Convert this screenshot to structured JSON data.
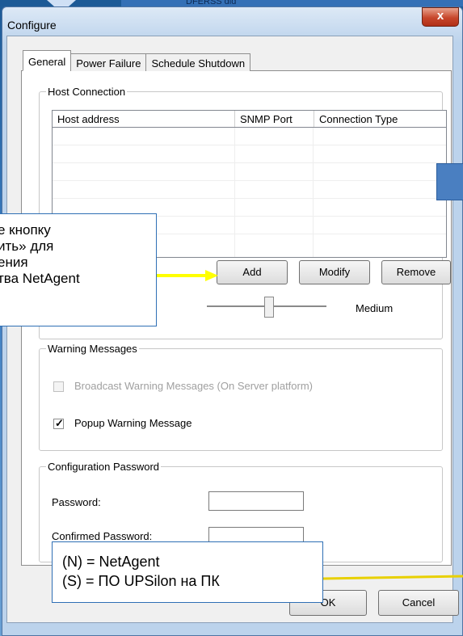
{
  "top_strip_text": "DFERSS dld",
  "window": {
    "title": "Configure",
    "close_label": "x"
  },
  "tabs": [
    {
      "label": "General"
    },
    {
      "label": "Power Failure"
    },
    {
      "label": "Schedule Shutdown"
    }
  ],
  "host_connection": {
    "legend": "Host Connection",
    "columns": [
      "Host address",
      "SNMP Port",
      "Connection Type"
    ],
    "rows": [],
    "buttons": {
      "add": "Add",
      "modify": "Modify",
      "remove": "Remove"
    }
  },
  "slider": {
    "value_label": "Medium",
    "level": 0.5
  },
  "warning_messages": {
    "legend": "Warning Messages",
    "broadcast": {
      "label": "Broadcast Warning Messages (On Server platform)",
      "checked": false,
      "enabled": false
    },
    "popup": {
      "label": "Popup Warning Message",
      "checked": true
    }
  },
  "configuration_password": {
    "legend": "Configuration Password",
    "password_label": "Password:",
    "password_value": "",
    "confirmed_label": "Confirmed Password:",
    "confirmed_value": ""
  },
  "dialog_buttons": {
    "ok": "OK",
    "cancel": "Cancel"
  },
  "callout_add": {
    "lines": [
      "е кнопку",
      "ить» для",
      "ения",
      "тва NetAgent"
    ]
  },
  "callout_legend": {
    "lines": [
      "(N) = NetAgent",
      "(S) = ПО UPSilon на ПК"
    ]
  },
  "colors": {
    "arrow": "#ffff00",
    "callout_border": "#2f6fb5",
    "pointer_line": "#e8d000"
  }
}
